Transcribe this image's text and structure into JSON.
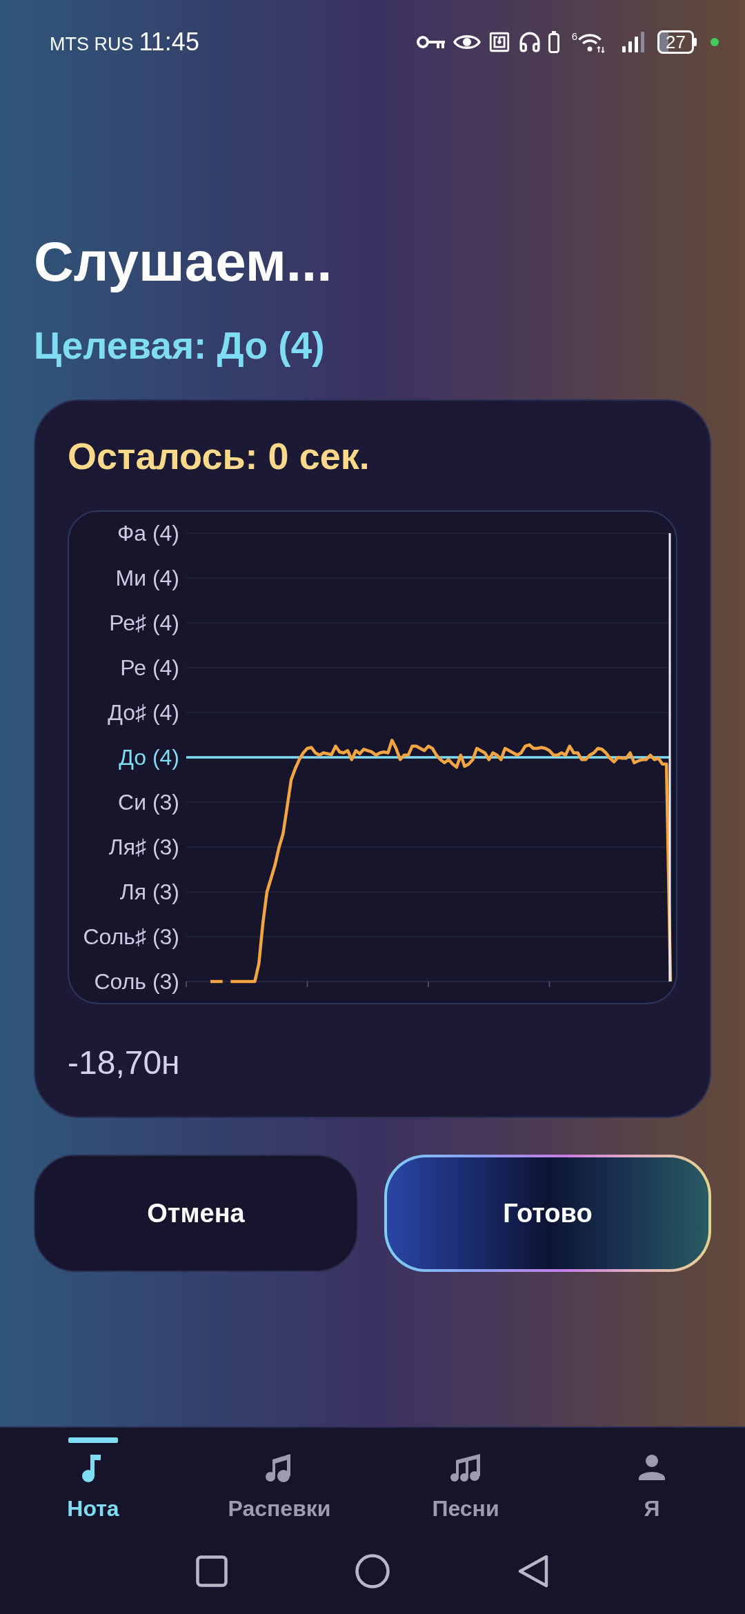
{
  "status_bar": {
    "carrier": "MTS RUS",
    "time": "11:45",
    "wifi_badge": "6",
    "battery": "27"
  },
  "header": {
    "title": "Слушаем...",
    "target": "Целевая: До (4)"
  },
  "card": {
    "countdown": "Осталось: 0 сек.",
    "pitch_graph": {
      "note_labels": [
        {
          "label": "Фа (4)",
          "selected": false
        },
        {
          "label": "Ми (4)",
          "selected": false
        },
        {
          "label": "Ре♯ (4)",
          "selected": false
        },
        {
          "label": "Ре (4)",
          "selected": false
        },
        {
          "label": "До♯ (4)",
          "selected": false
        },
        {
          "label": "До (4)",
          "selected": true
        },
        {
          "label": "Си (3)",
          "selected": false
        },
        {
          "label": "Ля♯ (3)",
          "selected": false
        },
        {
          "label": "Ля (3)",
          "selected": false
        },
        {
          "label": "Соль♯ (3)",
          "selected": false
        },
        {
          "label": "Соль (3)",
          "selected": false
        }
      ]
    },
    "deviation": "-18,70н"
  },
  "buttons": [
    {
      "label": "Отмена",
      "kind": "secondary"
    },
    {
      "label": "Готово",
      "kind": "primary"
    }
  ],
  "bottom_nav": [
    {
      "label": "Нота",
      "selected": true
    },
    {
      "label": "Распевки",
      "selected": false
    },
    {
      "label": "Песни",
      "selected": false
    },
    {
      "label": "Я",
      "selected": false
    }
  ]
}
